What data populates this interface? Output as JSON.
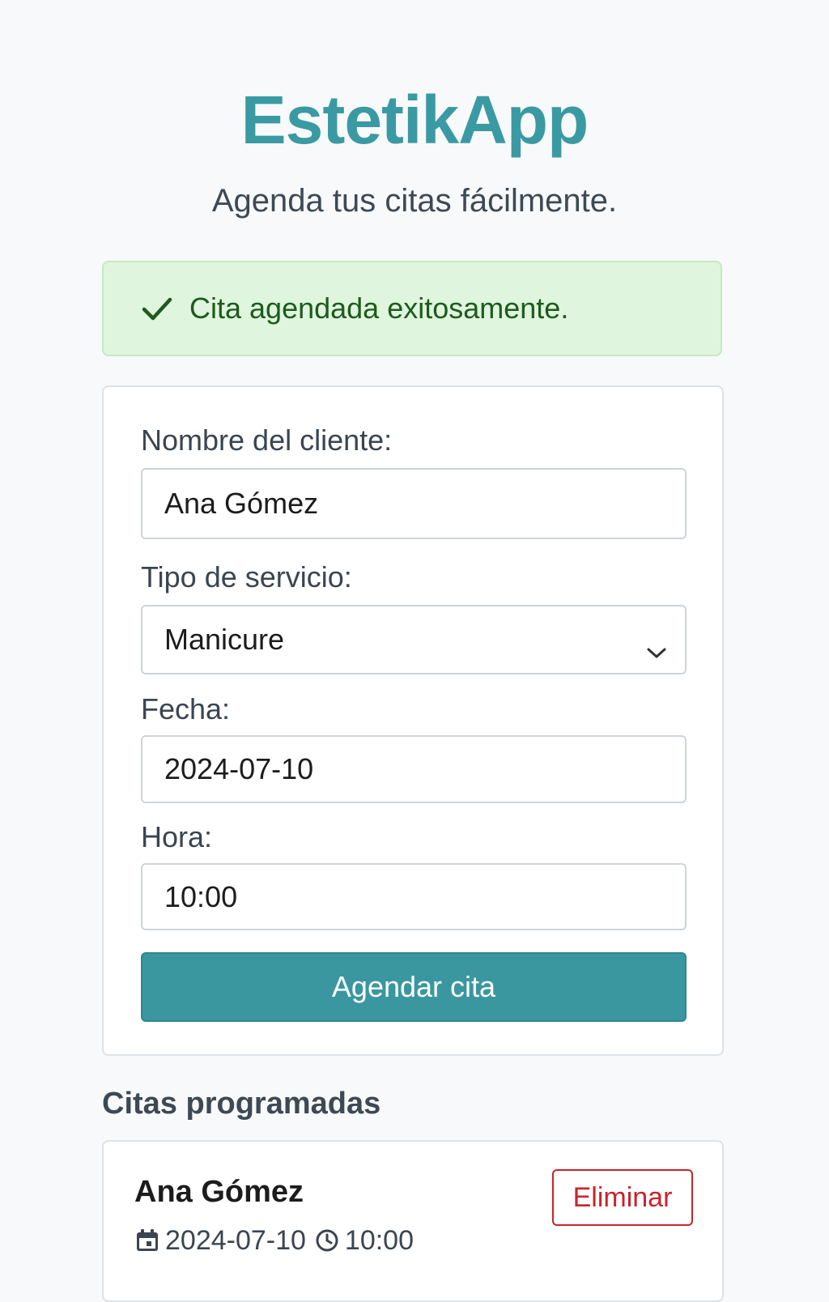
{
  "app": {
    "title": "EstetikApp",
    "subtitle": "Agenda tus citas fácilmente."
  },
  "alert": {
    "icon": "check-icon",
    "message": "Cita agendada exitosamente.",
    "color": "#1e5a1e",
    "background": "#dff5dd"
  },
  "form": {
    "name_label": "Nombre del cliente:",
    "name_value": "Ana Gómez",
    "service_label": "Tipo de servicio:",
    "service_value": "Manicure",
    "date_label": "Fecha:",
    "date_value": "2024-07-10",
    "time_label": "Hora:",
    "time_value": "10:00",
    "submit_label": "Agendar cita"
  },
  "appointments": {
    "heading": "Citas programadas",
    "items": [
      {
        "name": "Ana Gómez",
        "date": "2024-07-10",
        "time": "10:00",
        "delete_label": "Eliminar"
      }
    ]
  },
  "colors": {
    "accent": "#3a9aa3",
    "danger": "#c8242b"
  }
}
